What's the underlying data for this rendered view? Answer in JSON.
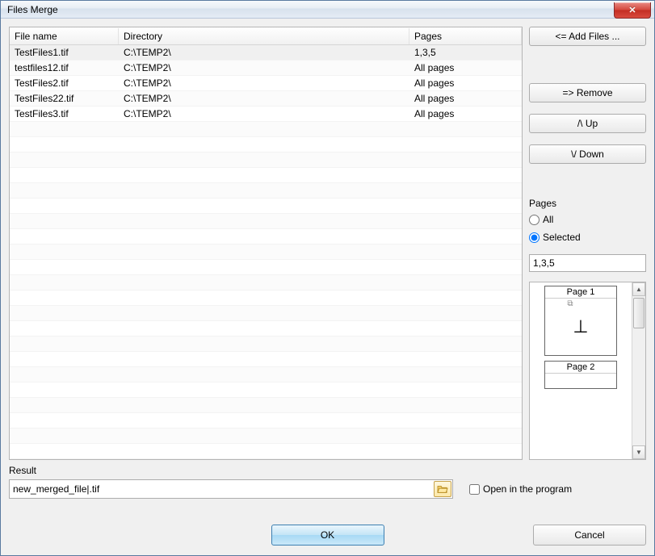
{
  "window": {
    "title": "Files Merge"
  },
  "columns": {
    "name": "File name",
    "dir": "Directory",
    "pages": "Pages"
  },
  "files": [
    {
      "name": "TestFiles1.tif",
      "dir": "C:\\TEMP2\\",
      "pages": "1,3,5",
      "selected": true
    },
    {
      "name": "testfiles12.tif",
      "dir": "C:\\TEMP2\\",
      "pages": "All pages",
      "selected": false
    },
    {
      "name": "TestFiles2.tif",
      "dir": "C:\\TEMP2\\",
      "pages": "All pages",
      "selected": false
    },
    {
      "name": "TestFiles22.tif",
      "dir": "C:\\TEMP2\\",
      "pages": "All pages",
      "selected": false
    },
    {
      "name": "TestFiles3.tif",
      "dir": "C:\\TEMP2\\",
      "pages": "All pages",
      "selected": false
    }
  ],
  "buttons": {
    "add": "<=  Add Files ...",
    "remove": "=>   Remove",
    "up": "/\\   Up",
    "down": "\\/   Down",
    "ok": "OK",
    "cancel": "Cancel"
  },
  "pages_panel": {
    "label": "Pages",
    "opt_all": "All",
    "opt_selected": "Selected",
    "choice": "selected",
    "value": "1,3,5"
  },
  "thumbs": [
    {
      "label": "Page 1",
      "glyph": "⊥"
    },
    {
      "label": "Page 2",
      "glyph": ""
    }
  ],
  "result": {
    "label": "Result",
    "value": "new_merged_file|.tif",
    "open_label": "Open in the program",
    "open_checked": false
  }
}
